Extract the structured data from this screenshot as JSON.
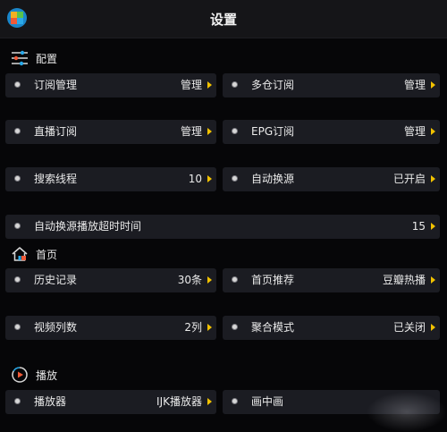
{
  "header": {
    "title": "设置"
  },
  "sections": {
    "config": "配置",
    "home": "首页",
    "playback": "播放"
  },
  "items": {
    "subscription": {
      "label": "订阅管理",
      "value": "管理"
    },
    "multi_repo": {
      "label": "多仓订阅",
      "value": "管理"
    },
    "live": {
      "label": "直播订阅",
      "value": "管理"
    },
    "epg": {
      "label": "EPG订阅",
      "value": "管理"
    },
    "search_threads": {
      "label": "搜索线程",
      "value": "10"
    },
    "auto_switch": {
      "label": "自动换源",
      "value": "已开启"
    },
    "auto_switch_timeout": {
      "label": "自动换源播放超时时间",
      "value": "15"
    },
    "history": {
      "label": "历史记录",
      "value": "30条"
    },
    "home_recommend": {
      "label": "首页推荐",
      "value": "豆瓣热播"
    },
    "video_columns": {
      "label": "视频列数",
      "value": "2列"
    },
    "aggregate_mode": {
      "label": "聚合模式",
      "value": "已关闭"
    },
    "player": {
      "label": "播放器",
      "value": "IJK播放器"
    },
    "pip": {
      "label": "画中画",
      "value": ""
    }
  },
  "colors": {
    "background": "#060608",
    "card": "#1b1c22",
    "arrow": "#f2c200",
    "accent_blue": "#2aa9e8",
    "accent_red": "#ef5a38"
  },
  "icons": {
    "app": "app-logo-icon",
    "config": "sliders-icon",
    "home": "home-icon",
    "playback": "play-circle-icon",
    "row": "radio-dot-icon",
    "chevron": "chevron-right-icon"
  }
}
